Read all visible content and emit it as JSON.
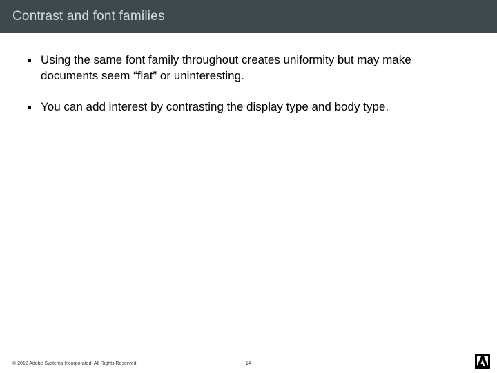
{
  "title": "Contrast and font families",
  "bullets": [
    "Using the same font family throughout creates uniformity but may make documents seem “flat” or uninteresting.",
    "You can add interest by contrasting the display type and body type."
  ],
  "footer": {
    "copyright": "© 2012 Adobe Systems Incorporated.  All Rights Reserved.",
    "page": "14"
  }
}
